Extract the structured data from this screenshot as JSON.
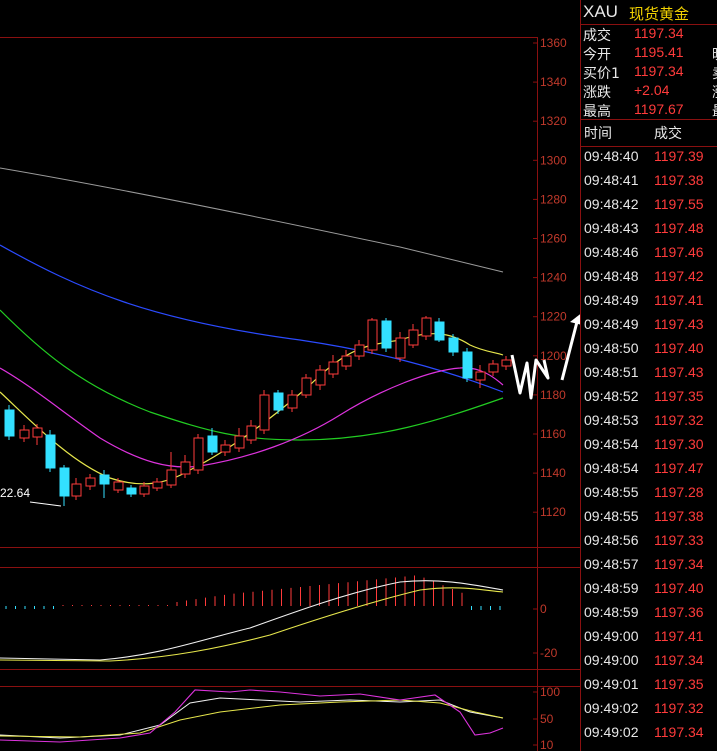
{
  "chart": {
    "main_axis_ticks": [
      "1360",
      "1340",
      "1320",
      "1300",
      "1280",
      "1260",
      "1240",
      "1220",
      "1200",
      "1180",
      "1160",
      "1140",
      "1120"
    ],
    "macd_axis_ticks": [
      "0",
      "-20"
    ],
    "kdj_axis_ticks": [
      "100",
      "50",
      "10"
    ],
    "low_annotation": "22.64"
  },
  "quote": {
    "symbol": "XAU",
    "name": "现货黄金",
    "rows": [
      {
        "label": "成交",
        "value": "1197.34",
        "extra": ""
      },
      {
        "label": "今开",
        "value": "1195.41",
        "extra": "晚"
      },
      {
        "label": "买价1",
        "value": "1197.34",
        "extra": "卖"
      },
      {
        "label": "涨跌",
        "value": "+2.04",
        "extra": "涨"
      },
      {
        "label": "最高",
        "value": "1197.67",
        "extra": "最"
      }
    ]
  },
  "ticks": {
    "header_time": "时间",
    "header_price": "成交",
    "rows": [
      {
        "time": "09:48:40",
        "price": "1197.39"
      },
      {
        "time": "09:48:41",
        "price": "1197.38"
      },
      {
        "time": "09:48:42",
        "price": "1197.55"
      },
      {
        "time": "09:48:43",
        "price": "1197.48"
      },
      {
        "time": "09:48:46",
        "price": "1197.46"
      },
      {
        "time": "09:48:48",
        "price": "1197.42"
      },
      {
        "time": "09:48:49",
        "price": "1197.41"
      },
      {
        "time": "09:48:49",
        "price": "1197.43"
      },
      {
        "time": "09:48:50",
        "price": "1197.40"
      },
      {
        "time": "09:48:51",
        "price": "1197.43"
      },
      {
        "time": "09:48:52",
        "price": "1197.35"
      },
      {
        "time": "09:48:53",
        "price": "1197.32"
      },
      {
        "time": "09:48:54",
        "price": "1197.30"
      },
      {
        "time": "09:48:54",
        "price": "1197.47"
      },
      {
        "time": "09:48:55",
        "price": "1197.28"
      },
      {
        "time": "09:48:55",
        "price": "1197.38"
      },
      {
        "time": "09:48:56",
        "price": "1197.33"
      },
      {
        "time": "09:48:57",
        "price": "1197.34"
      },
      {
        "time": "09:48:59",
        "price": "1197.40"
      },
      {
        "time": "09:48:59",
        "price": "1197.36"
      },
      {
        "time": "09:49:00",
        "price": "1197.41"
      },
      {
        "time": "09:49:00",
        "price": "1197.34"
      },
      {
        "time": "09:49:01",
        "price": "1197.35"
      },
      {
        "time": "09:49:02",
        "price": "1197.32"
      },
      {
        "time": "09:49:02",
        "price": "1197.34"
      }
    ]
  },
  "colors": {
    "up": "#ff3b3b",
    "down": "#33e0ff",
    "axis": "#8a1010",
    "ma_gray": "#9a9a9a",
    "ma_blue": "#2b4bff",
    "ma_green": "#22cc22",
    "ma_magenta": "#dd33dd",
    "ma_yellow": "#e6e64c"
  }
}
